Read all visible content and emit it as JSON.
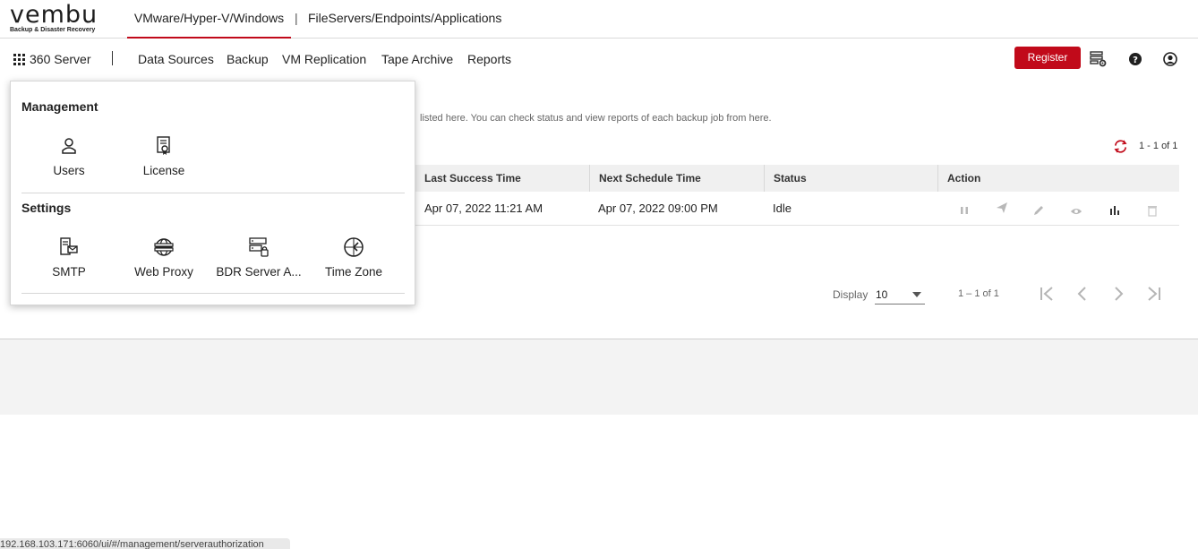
{
  "brand": {
    "logo_word": "vembu",
    "logo_tagline": "Backup & Disaster Recovery",
    "accent_color": "#c10a1a"
  },
  "product_tabs": [
    {
      "label": "VMware/Hyper-V/Windows",
      "active": true
    },
    {
      "label": "FileServers/Endpoints/Applications",
      "active": false
    }
  ],
  "product_tab_separator": "|",
  "navbar": {
    "server_label": "360 Server",
    "items": [
      "Data Sources",
      "Backup",
      "VM Replication",
      "Tape Archive",
      "Reports"
    ],
    "register_label": "Register",
    "icons": [
      "server-settings-icon",
      "help-icon",
      "user-account-icon"
    ]
  },
  "content": {
    "description": "listed here. You can check status and view reports of each backup job from here.",
    "count_top": "1 - 1 of 1",
    "columns": [
      "Last Success Time",
      "Next Schedule Time",
      "Status",
      "Action"
    ],
    "rows": [
      {
        "last_success": "Apr 07, 2022 11:21 AM",
        "next_schedule": "Apr 07, 2022 09:00 PM",
        "status": "Idle"
      }
    ],
    "action_icons": [
      "pause-icon",
      "send-icon",
      "edit-icon",
      "view-icon",
      "report-icon",
      "delete-icon"
    ],
    "display_label": "Display",
    "display_value": "10",
    "count_bottom": "1 – 1 of 1",
    "pagination_icons": [
      "first-page-icon",
      "prev-page-icon",
      "next-page-icon",
      "last-page-icon"
    ]
  },
  "menu": {
    "management_title": "Management",
    "management_items": [
      {
        "label": "Users",
        "icon": "user-icon"
      },
      {
        "label": "License",
        "icon": "license-icon"
      }
    ],
    "settings_title": "Settings",
    "settings_items": [
      {
        "label": "SMTP",
        "icon": "smtp-icon"
      },
      {
        "label": "Web Proxy",
        "icon": "web-proxy-icon"
      },
      {
        "label": "BDR Server A...",
        "icon": "bdr-server-auth-icon"
      },
      {
        "label": "Time Zone",
        "icon": "time-zone-icon"
      }
    ]
  },
  "status_bar_url": "192.168.103.171:6060/ui/#/management/serverauthorization"
}
